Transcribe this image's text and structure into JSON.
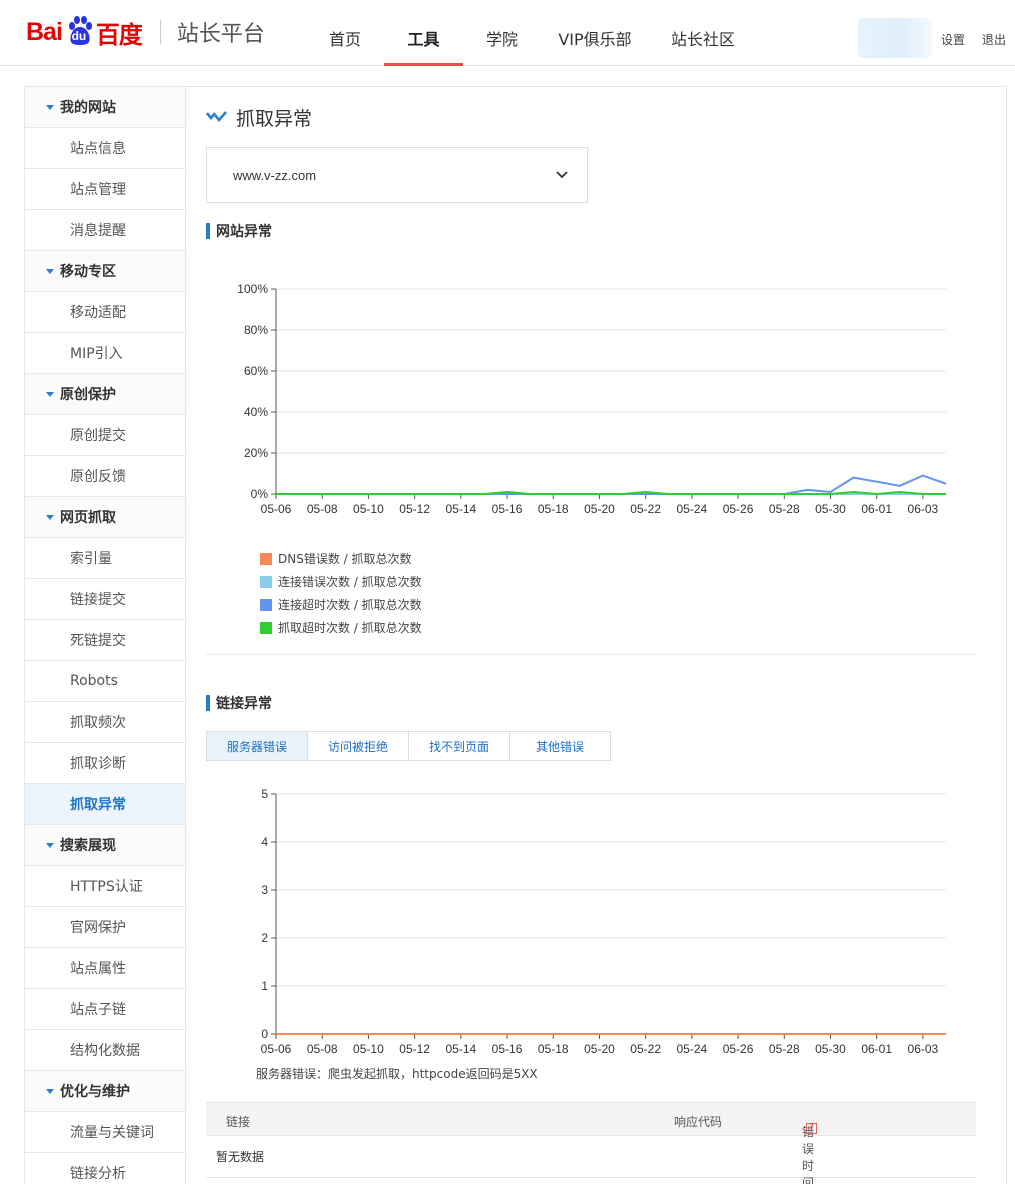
{
  "header": {
    "logo": {
      "bai": "Bai",
      "du": "du",
      "cn": "百度",
      "product": "站长平台"
    },
    "nav": [
      {
        "label": "首页",
        "active": false
      },
      {
        "label": "工具",
        "active": true
      },
      {
        "label": "学院",
        "active": false
      },
      {
        "label": "VIP俱乐部",
        "active": false
      },
      {
        "label": "站长社区",
        "active": false
      }
    ],
    "settings_label": "设置",
    "logout_label": "退出"
  },
  "sidebar": {
    "groups": [
      {
        "label": "我的网站",
        "items": [
          "站点信息",
          "站点管理",
          "消息提醒"
        ]
      },
      {
        "label": "移动专区",
        "items": [
          "移动适配",
          "MIP引入"
        ]
      },
      {
        "label": "原创保护",
        "items": [
          "原创提交",
          "原创反馈"
        ]
      },
      {
        "label": "网页抓取",
        "items": [
          "索引量",
          "链接提交",
          "死链提交",
          "Robots",
          "抓取频次",
          "抓取诊断",
          "抓取异常"
        ]
      },
      {
        "label": "搜索展现",
        "items": [
          "HTTPS认证",
          "官网保护",
          "站点属性",
          "站点子链",
          "结构化数据"
        ]
      },
      {
        "label": "优化与维护",
        "items": [
          "流量与关键词",
          "链接分析"
        ]
      }
    ],
    "active_item": "抓取异常"
  },
  "main": {
    "title": "抓取异常",
    "site_select": {
      "value": "www.v-zz.com"
    },
    "section1_title": "网站异常",
    "section2_title": "链接异常",
    "tabs": [
      {
        "label": "服务器错误",
        "active": true
      },
      {
        "label": "访问被拒绝",
        "active": false
      },
      {
        "label": "找不到页面",
        "active": false
      },
      {
        "label": "其他错误",
        "active": false
      }
    ],
    "chart_note": "服务器错误：爬虫发起抓取，httpcode返回码是5XX",
    "table": {
      "columns": [
        "链接",
        "响应代码",
        "错误时间"
      ],
      "help_icon": "?",
      "empty_text": "暂无数据"
    }
  },
  "chart_data": [
    {
      "type": "line",
      "x": [
        "05-06",
        "05-07",
        "05-08",
        "05-09",
        "05-10",
        "05-11",
        "05-12",
        "05-13",
        "05-14",
        "05-15",
        "05-16",
        "05-17",
        "05-18",
        "05-19",
        "05-20",
        "05-21",
        "05-22",
        "05-23",
        "05-24",
        "05-25",
        "05-26",
        "05-27",
        "05-28",
        "05-29",
        "05-30",
        "05-31",
        "06-01",
        "06-02",
        "06-03",
        "06-04"
      ],
      "xticks": [
        "05-06",
        "05-08",
        "05-10",
        "05-12",
        "05-14",
        "05-16",
        "05-18",
        "05-20",
        "05-22",
        "05-24",
        "05-26",
        "05-28",
        "05-30",
        "06-01",
        "06-03"
      ],
      "ylim": [
        0,
        100
      ],
      "yticks": [
        "0%",
        "20%",
        "40%",
        "60%",
        "80%",
        "100%"
      ],
      "series": [
        {
          "name": "DNS错误数 / 抓取总次数",
          "color": "#f58a57",
          "values": [
            0,
            0,
            0,
            0,
            0,
            0,
            0,
            0,
            0,
            0,
            0,
            0,
            0,
            0,
            0,
            0,
            0,
            0,
            0,
            0,
            0,
            0,
            0,
            0,
            0,
            0,
            0,
            0,
            0,
            0
          ]
        },
        {
          "name": "连接错误次数 / 抓取总次数",
          "color": "#87ceeb",
          "values": [
            0,
            0,
            0,
            0,
            0,
            0,
            0,
            0,
            0,
            0,
            0,
            0,
            0,
            0,
            0,
            0,
            0,
            0,
            0,
            0,
            0,
            0,
            0,
            0,
            0,
            0,
            0,
            0,
            0,
            0
          ]
        },
        {
          "name": "连接超时次数 / 抓取总次数",
          "color": "#6495ed",
          "values": [
            0,
            0,
            0,
            0,
            0,
            0,
            0,
            0,
            0,
            0,
            0,
            0,
            0,
            0,
            0,
            0,
            0,
            0,
            0,
            0,
            0,
            0,
            0,
            2,
            1,
            8,
            6,
            4,
            9,
            5
          ]
        },
        {
          "name": "抓取超时次数 / 抓取总次数",
          "color": "#32cd32",
          "values": [
            0,
            0,
            0,
            0,
            0,
            0,
            0,
            0,
            0,
            0,
            1,
            0,
            0,
            0,
            0,
            0,
            1,
            0,
            0,
            0,
            0,
            0,
            0,
            0,
            0,
            1,
            0,
            1,
            0,
            0
          ]
        }
      ],
      "grid": true,
      "legend": "bottom-left"
    },
    {
      "type": "line",
      "x": [
        "05-06",
        "05-07",
        "05-08",
        "05-09",
        "05-10",
        "05-11",
        "05-12",
        "05-13",
        "05-14",
        "05-15",
        "05-16",
        "05-17",
        "05-18",
        "05-19",
        "05-20",
        "05-21",
        "05-22",
        "05-23",
        "05-24",
        "05-25",
        "05-26",
        "05-27",
        "05-28",
        "05-29",
        "05-30",
        "05-31",
        "06-01",
        "06-02",
        "06-03",
        "06-04"
      ],
      "xticks": [
        "05-06",
        "05-08",
        "05-10",
        "05-12",
        "05-14",
        "05-16",
        "05-18",
        "05-20",
        "05-22",
        "05-24",
        "05-26",
        "05-28",
        "05-30",
        "06-01",
        "06-03"
      ],
      "ylim": [
        0,
        5
      ],
      "yticks": [
        "0",
        "1",
        "2",
        "3",
        "4",
        "5"
      ],
      "series": [
        {
          "color": "#f58a57",
          "values": [
            0,
            0,
            0,
            0,
            0,
            0,
            0,
            0,
            0,
            0,
            0,
            0,
            0,
            0,
            0,
            0,
            0,
            0,
            0,
            0,
            0,
            0,
            0,
            0,
            0,
            0,
            0,
            0,
            0,
            0
          ]
        }
      ],
      "grid": true
    }
  ]
}
